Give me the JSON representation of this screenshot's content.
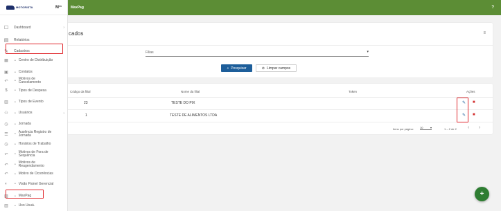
{
  "brand": {
    "logo_text": "MOTORISTA",
    "badge": "M¹¹"
  },
  "topbar": {
    "title": "MaxPag",
    "help": "?"
  },
  "sidebar": {
    "items": [
      {
        "label": "Dashboard",
        "icon": "monitor-icon",
        "glyph": "☐",
        "chevron": "›"
      },
      {
        "label": "Relatórios",
        "icon": "report-icon",
        "glyph": "▤"
      },
      {
        "label": "Cadastros",
        "icon": "pencil-icon",
        "glyph": "✎"
      }
    ],
    "subitems": [
      {
        "label": "Centro de Distribuição",
        "icon": "building-icon",
        "glyph": "▦"
      },
      {
        "label": "Contatos",
        "icon": "contact-icon",
        "glyph": "▣"
      },
      {
        "label": "Motivos de Cancelamento",
        "icon": "undo-icon",
        "glyph": "↶"
      },
      {
        "label": "Tipos de Despesa",
        "icon": "dollar-icon",
        "glyph": "$"
      },
      {
        "label": "Tipos de Evento",
        "icon": "calendar-icon",
        "glyph": "▥"
      },
      {
        "label": "Usuários",
        "icon": "users-icon",
        "glyph": "⚇",
        "chevron": "›"
      },
      {
        "label": "Jornada",
        "icon": "clock-icon",
        "glyph": "◷"
      },
      {
        "label": "Ausência Registro de Jornada",
        "icon": "list-icon",
        "glyph": "☰"
      },
      {
        "label": "Horários de Trabalho",
        "icon": "clock-icon",
        "glyph": "◷"
      },
      {
        "label": "Motivos de Fora de Sequência",
        "icon": "undo-icon",
        "glyph": "↶"
      },
      {
        "label": "Motivos de Reagendamento",
        "icon": "undo-icon",
        "glyph": "↶"
      },
      {
        "label": "Motivo de Ocorrências",
        "icon": "undo-icon",
        "glyph": "↶"
      },
      {
        "label": "Visão Painel Gerencial",
        "icon": "gauge-icon",
        "glyph": "◐"
      },
      {
        "label": "MaxPag",
        "icon": "payment-icon",
        "glyph": "▨"
      },
      {
        "label": "Uso Usuá.",
        "icon": "calendar-icon",
        "glyph": "▥"
      }
    ]
  },
  "search": {
    "title": "cados",
    "filter_icon": "≡",
    "field_placeholder": "Filias",
    "caret": "▾",
    "search_label": "Pesquisar",
    "search_icon": "⌕",
    "clear_label": "Limpar campos",
    "clear_icon": "⊘"
  },
  "table": {
    "columns": [
      "Código da filial",
      "Nome da filial",
      "Token",
      "Ações"
    ],
    "rows": [
      {
        "code": "23",
        "name": "TESTE DO PIX",
        "token": ""
      },
      {
        "code": "1",
        "name": "TESTE DE ALIMENTOS LTDA",
        "token": ""
      }
    ],
    "edit_icon": "✎",
    "delete_icon": "■",
    "pager": {
      "items_label": "Itens por página:",
      "items_value": "10",
      "range": "1 – 2 de 2",
      "prev": "‹",
      "next": "›"
    }
  },
  "fab": "+",
  "colors": {
    "topbar": "#5c8d35",
    "primary": "#1d5e9a",
    "highlight": "#e0262b",
    "fab": "#2e7d32"
  }
}
